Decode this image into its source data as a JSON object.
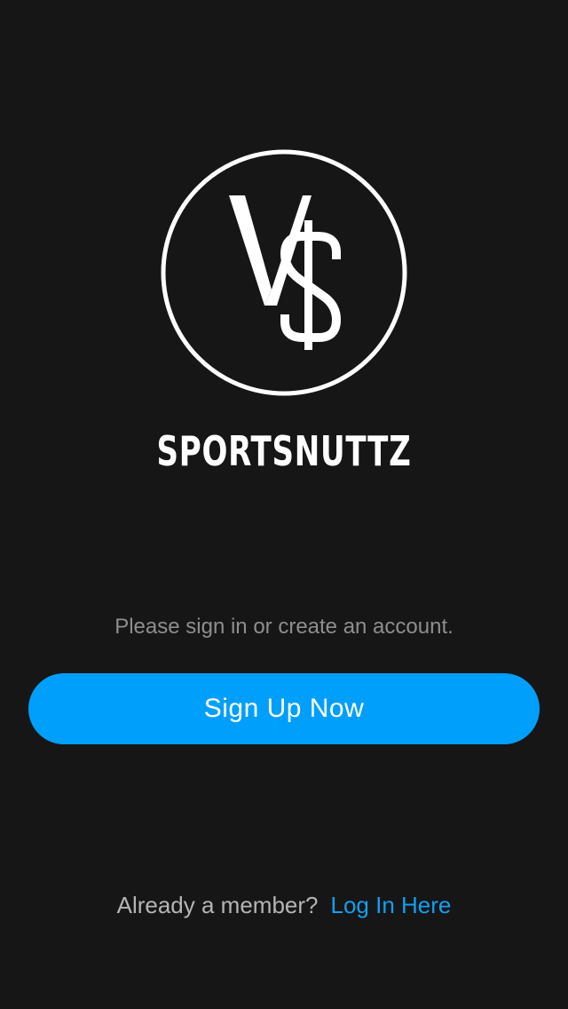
{
  "logo": {
    "icon": "vs-dollar-logo",
    "glyph_v": "V",
    "glyph_s": "$"
  },
  "brand": {
    "name": "SPORTSNUTTZ"
  },
  "auth": {
    "prompt": "Please sign in or create an account.",
    "signup_label": "Sign Up Now",
    "member_question": "Already a member?",
    "login_label": "Log In Here"
  },
  "colors": {
    "background": "#161616",
    "accent": "#009ffc",
    "link": "#129ff0",
    "text_muted": "#8e8e8e"
  }
}
